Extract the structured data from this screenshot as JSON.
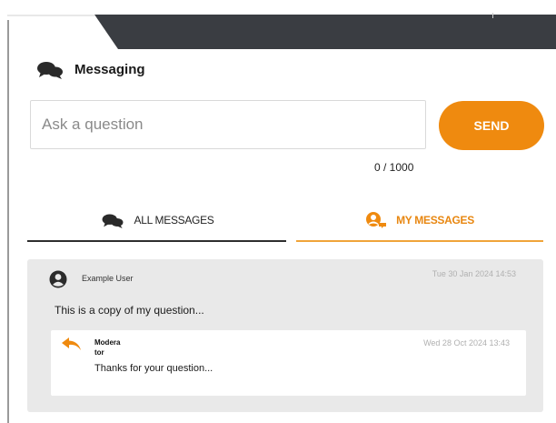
{
  "header": {
    "title": "Messaging"
  },
  "ask": {
    "placeholder": "Ask a question",
    "value": ""
  },
  "send_label": "SEND",
  "counter": "0 / 1000",
  "tabs": [
    {
      "label": "ALL MESSAGES",
      "active": false
    },
    {
      "label": "MY MESSAGES",
      "active": true
    }
  ],
  "message": {
    "author": "Example User",
    "timestamp": "Tue 30 Jan 2024 14:53",
    "text": "This is a copy of my question...",
    "reply": {
      "author": "Moderator",
      "timestamp": "Wed 28 Oct 2024 13:43",
      "text": "Thanks for your question..."
    }
  },
  "colors": {
    "accent": "#ef8a0f",
    "dark_band": "#3a3d42",
    "panel": "#e9e9e9"
  },
  "icons": {
    "header": "chat-bubbles-icon",
    "all_tab": "chat-bubbles-icon",
    "my_tab": "user-chat-icon",
    "author": "user-avatar-icon",
    "reply": "reply-arrow-icon"
  }
}
